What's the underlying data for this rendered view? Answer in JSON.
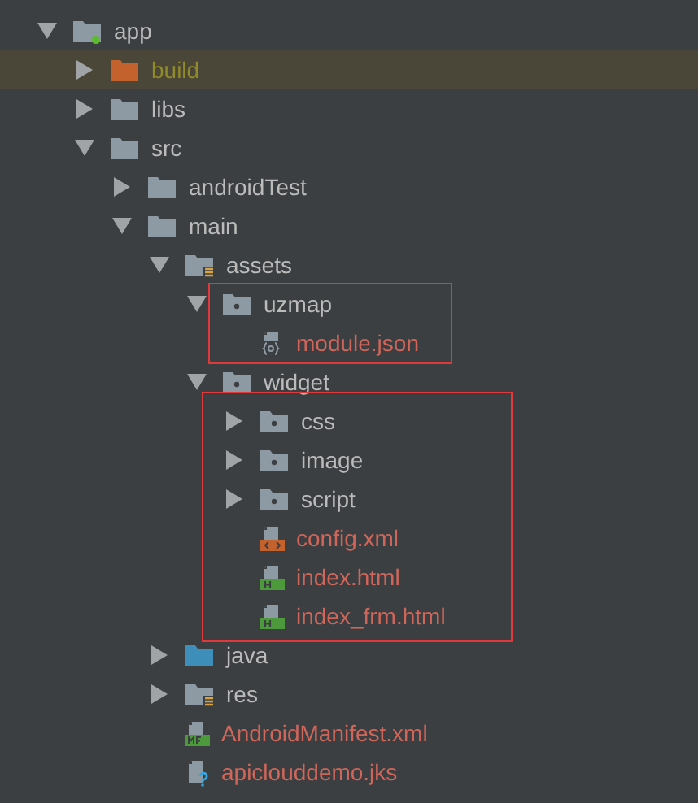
{
  "tree": [
    {
      "name": "app",
      "kind": "folder-module",
      "ignored": false,
      "untracked": false,
      "expanded": true,
      "selected": false,
      "children": [
        {
          "name": "build",
          "kind": "folder-excluded",
          "ignored": true,
          "untracked": false,
          "expanded": false,
          "selected": true
        },
        {
          "name": "libs",
          "kind": "folder",
          "ignored": false,
          "untracked": false,
          "expanded": false,
          "selected": false
        },
        {
          "name": "src",
          "kind": "folder",
          "ignored": false,
          "untracked": false,
          "expanded": true,
          "selected": false,
          "children": [
            {
              "name": "androidTest",
              "kind": "folder",
              "ignored": false,
              "untracked": false,
              "expanded": false,
              "selected": false
            },
            {
              "name": "main",
              "kind": "folder",
              "ignored": false,
              "untracked": false,
              "expanded": true,
              "selected": false,
              "children": [
                {
                  "name": "assets",
                  "kind": "folder-resources",
                  "ignored": false,
                  "untracked": false,
                  "expanded": true,
                  "selected": false,
                  "children": [
                    {
                      "name": "uzmap",
                      "kind": "folder-package",
                      "ignored": false,
                      "untracked": false,
                      "expanded": true,
                      "selected": false,
                      "boxed": true,
                      "children": [
                        {
                          "name": "module.json",
                          "kind": "json",
                          "ignored": false,
                          "untracked": true,
                          "selected": false
                        }
                      ]
                    },
                    {
                      "name": "widget",
                      "kind": "folder-package",
                      "ignored": false,
                      "untracked": false,
                      "expanded": true,
                      "selected": false,
                      "children_boxed": true,
                      "children": [
                        {
                          "name": "css",
                          "kind": "folder-package",
                          "ignored": false,
                          "untracked": false,
                          "expanded": false,
                          "selected": false
                        },
                        {
                          "name": "image",
                          "kind": "folder-package",
                          "ignored": false,
                          "untracked": false,
                          "expanded": false,
                          "selected": false
                        },
                        {
                          "name": "script",
                          "kind": "folder-package",
                          "ignored": false,
                          "untracked": false,
                          "expanded": false,
                          "selected": false
                        },
                        {
                          "name": "config.xml",
                          "kind": "xml",
                          "ignored": false,
                          "untracked": true,
                          "selected": false
                        },
                        {
                          "name": "index.html",
                          "kind": "html",
                          "ignored": false,
                          "untracked": true,
                          "selected": false
                        },
                        {
                          "name": "index_frm.html",
                          "kind": "html",
                          "ignored": false,
                          "untracked": true,
                          "selected": false
                        }
                      ]
                    }
                  ]
                },
                {
                  "name": "java",
                  "kind": "folder-source",
                  "ignored": false,
                  "untracked": false,
                  "expanded": false,
                  "selected": false
                },
                {
                  "name": "res",
                  "kind": "folder-resources",
                  "ignored": false,
                  "untracked": false,
                  "expanded": false,
                  "selected": false
                },
                {
                  "name": "AndroidManifest.xml",
                  "kind": "manifest",
                  "ignored": false,
                  "untracked": true,
                  "selected": false
                },
                {
                  "name": "apiclouddemo.jks",
                  "kind": "unknown",
                  "ignored": false,
                  "untracked": true,
                  "selected": false
                }
              ]
            }
          ]
        }
      ]
    }
  ]
}
